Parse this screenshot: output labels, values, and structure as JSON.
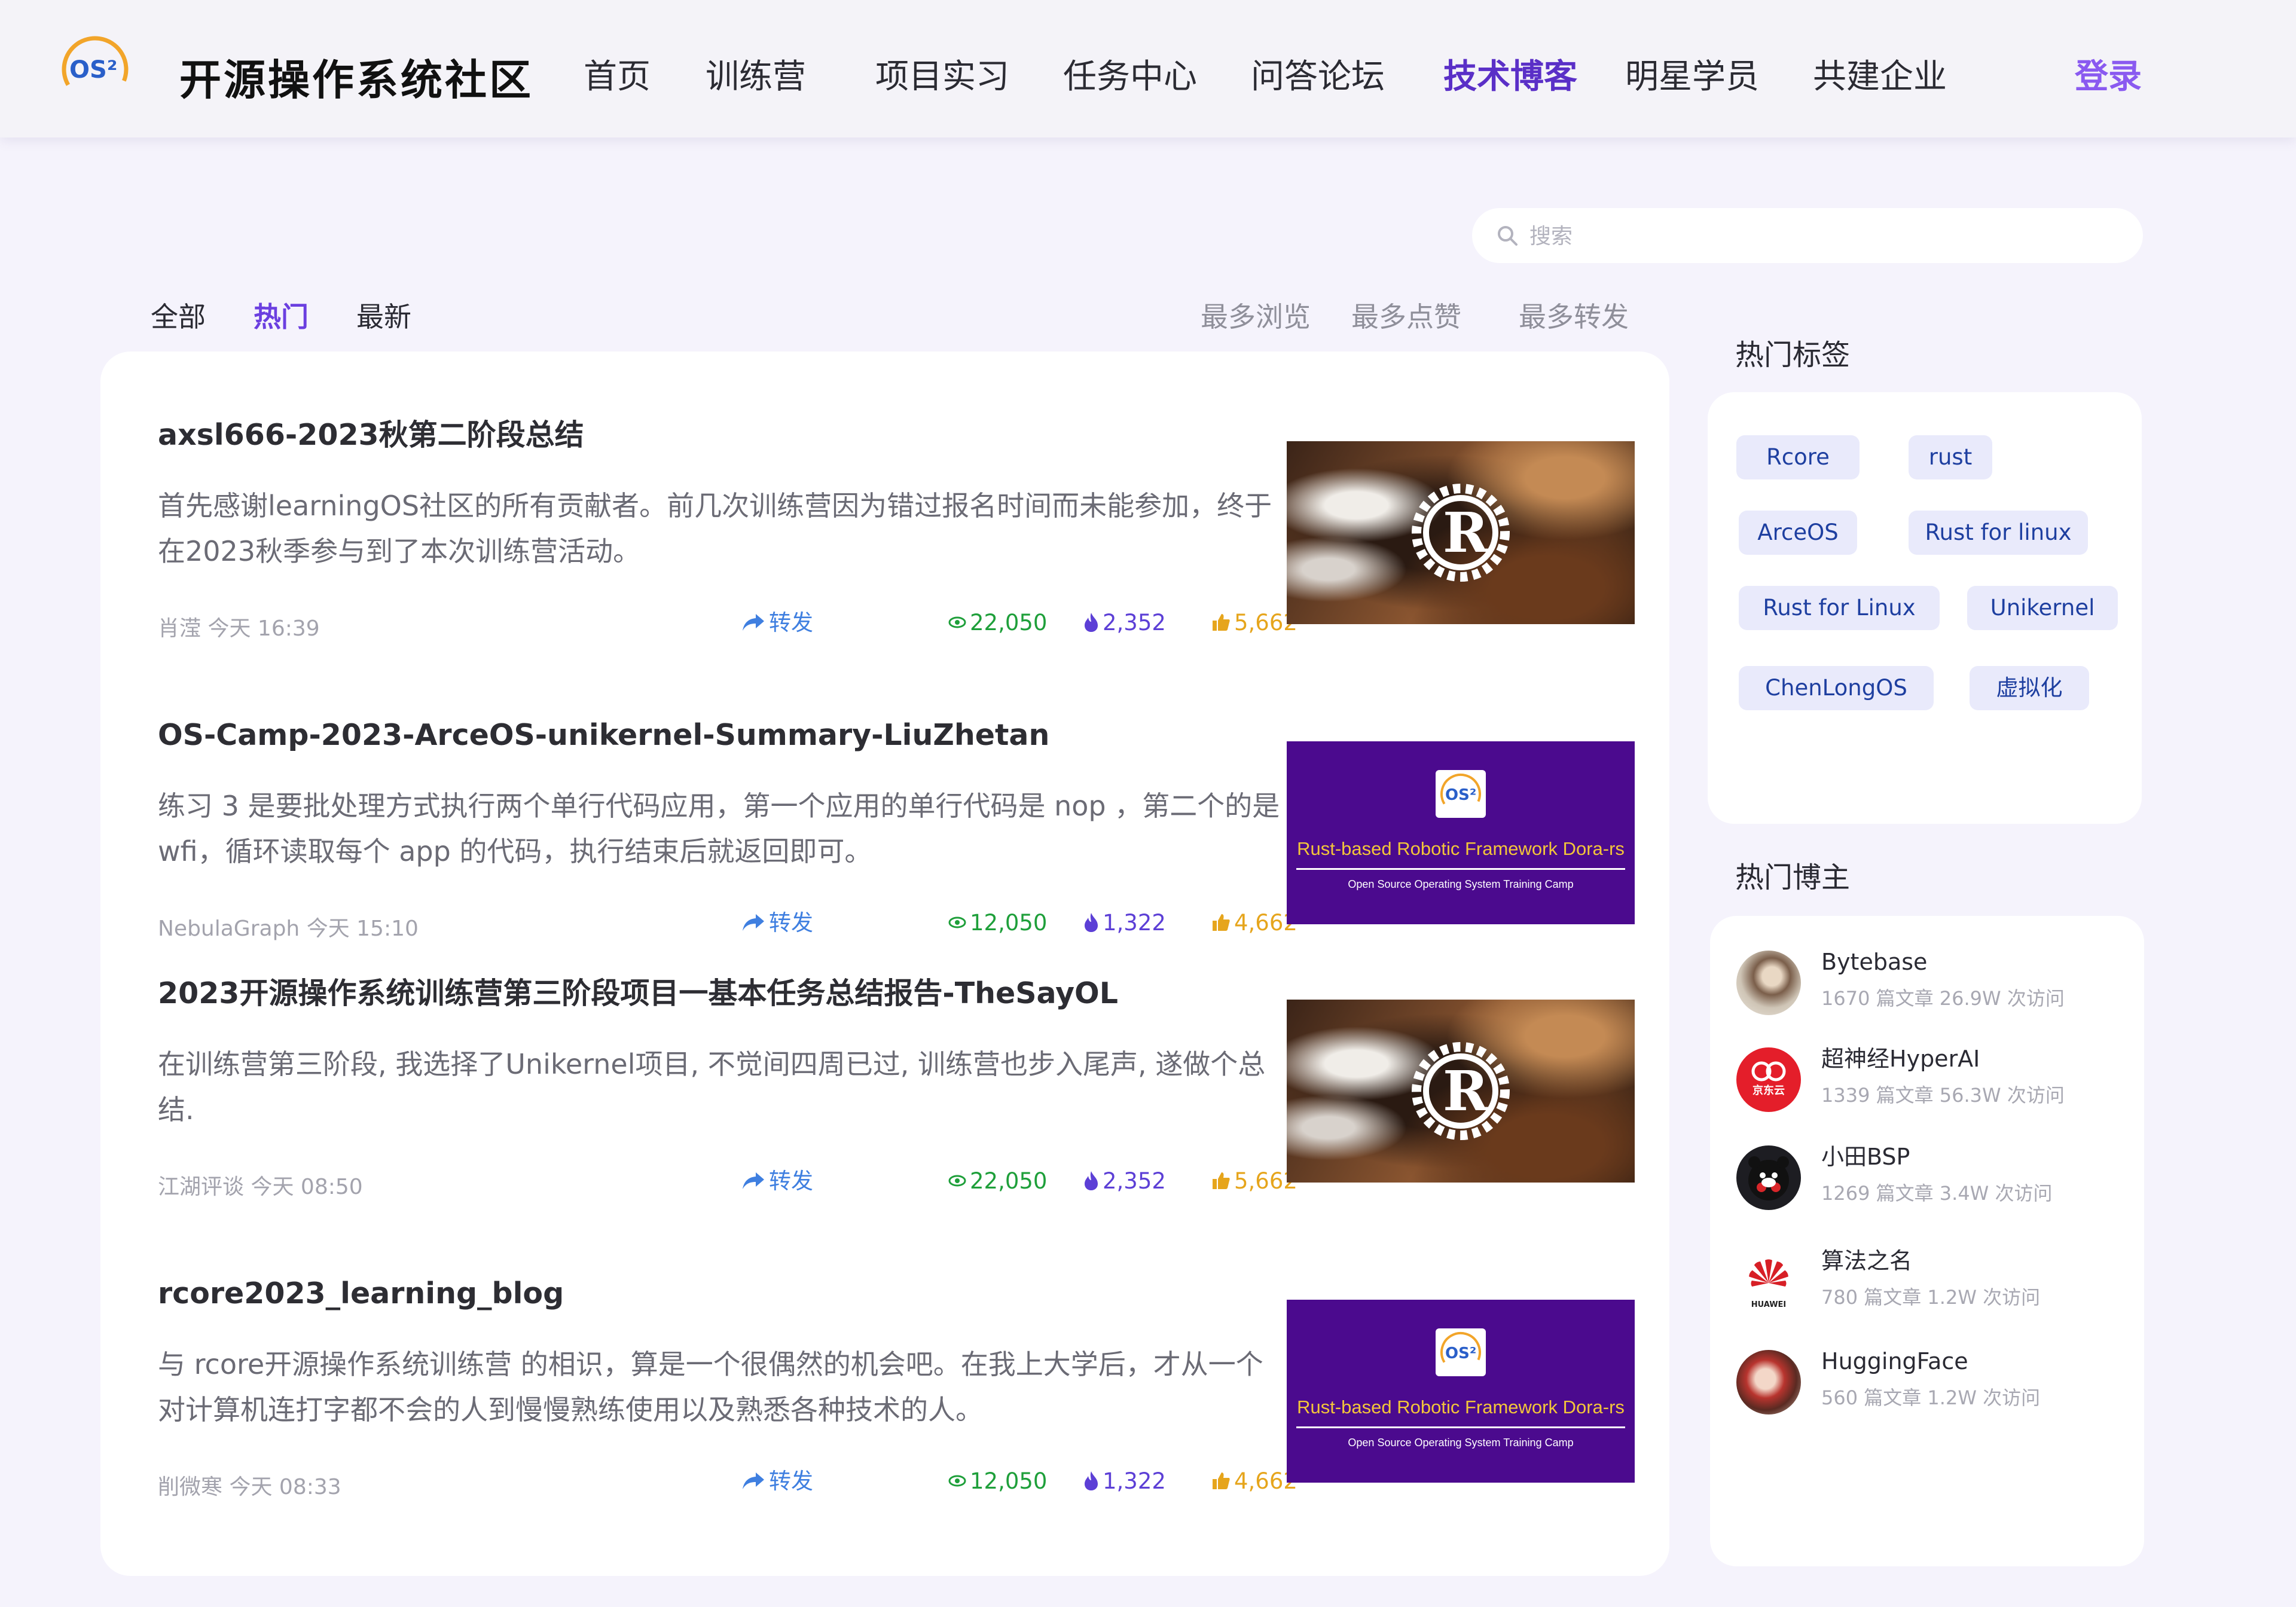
{
  "header": {
    "site_name": "开源操作系统社区",
    "logo_text": "OS²",
    "nav": [
      {
        "label": "首页"
      },
      {
        "label": "训练营"
      },
      {
        "label": "项目实习"
      },
      {
        "label": "任务中心"
      },
      {
        "label": "问答论坛"
      },
      {
        "label": "技术博客",
        "active": true
      },
      {
        "label": "明星学员"
      },
      {
        "label": "共建企业"
      }
    ],
    "login_label": "登录"
  },
  "search": {
    "placeholder": "搜索"
  },
  "filters": {
    "tabs": [
      {
        "label": "全部"
      },
      {
        "label": "热门",
        "active": true
      },
      {
        "label": "最新"
      }
    ],
    "sorts": [
      {
        "label": "最多浏览"
      },
      {
        "label": "最多点赞"
      },
      {
        "label": "最多转发"
      }
    ]
  },
  "posts": [
    {
      "title": "axsl666-2023秋第二阶段总结",
      "excerpt": "首先感谢learningOS社区的所有贡献者。前几次训练营因为错过报名时间而未能参加，终于在2023秋季参与到了本次训练营活动。",
      "author": "肖滢",
      "time": "今天 16:39",
      "share_label": "转发",
      "views": "22,050",
      "hot": "2,352",
      "likes": "5,662",
      "thumbnail": "rust-logo-image"
    },
    {
      "title": "OS-Camp-2023-ArceOS-unikernel-Summary-LiuZhetan",
      "excerpt": "练习 3 是要批处理方式执行两个单行代码应用，第一个应用的单行代码是 nop ，第二个的是 wfi，循环读取每个 app 的代码，执行结束后就返回即可。",
      "author": "NebulaGraph",
      "time": "今天 15:10",
      "share_label": "转发",
      "views": "12,050",
      "hot": "1,322",
      "likes": "4,662",
      "thumbnail": "dora-banner-image"
    },
    {
      "title": "2023开源操作系统训练营第三阶段项目一基本任务总结报告-TheSayOL",
      "excerpt": "在训练营第三阶段, 我选择了Unikernel项目, 不觉间四周已过, 训练营也步入尾声, 遂做个总结.",
      "author": "江湖评谈",
      "time": "今天 08:50",
      "share_label": "转发",
      "views": "22,050",
      "hot": "2,352",
      "likes": "5,662",
      "thumbnail": "rust-logo-image"
    },
    {
      "title": "rcore2023_learning_blog",
      "excerpt": "与 rcore开源操作系统训练营 的相识，算是一个很偶然的机会吧。在我上大学后，才从一个对计算机连打字都不会的人到慢慢熟练使用以及熟悉各种技术的人。",
      "author": "削微寒",
      "time": "今天 08:33",
      "share_label": "转发",
      "views": "12,050",
      "hot": "1,322",
      "likes": "4,662",
      "thumbnail": "dora-banner-image"
    }
  ],
  "banner": {
    "logo_text": "OS²",
    "title": "Rust-based Robotic Framework Dora-rs",
    "subtitle": "Open Source Operating System Training Camp"
  },
  "sidebar": {
    "tags_heading": "热门标签",
    "tags": [
      "Rcore",
      "rust",
      "ArceOS",
      "Rust for linux",
      "Rust for Linux",
      "Unikernel",
      "ChenLongOS",
      "虚拟化"
    ],
    "bloggers_heading": "热门博主",
    "bloggers": [
      {
        "name": "Bytebase",
        "stats": "1670 篇文章 26.9W 次访问",
        "avatar": "photo-avatar"
      },
      {
        "name": "超神经HyperAI",
        "stats": "1339 篇文章 56.3W 次访问",
        "avatar": "jd-cloud-avatar",
        "avatar_text": "京东云"
      },
      {
        "name": "小田BSP",
        "stats": "1269 篇文章 3.4W 次访问",
        "avatar": "kumamon-avatar"
      },
      {
        "name": "算法之名",
        "stats": "780 篇文章 1.2W 次访问",
        "avatar": "huawei-avatar",
        "avatar_text": "HUAWEI"
      },
      {
        "name": "HuggingFace",
        "stats": "560 篇文章 1.2W 次访问",
        "avatar": "photo-avatar"
      }
    ]
  },
  "colors": {
    "accent": "#5a2fc7",
    "login": "#8a5af0",
    "share": "#3f7fe0",
    "views": "#1e9f3a",
    "hot": "#5c3fd6",
    "likes": "#e6a51c",
    "tag_bg": "#e9eafb",
    "tag_text": "#1e3fa0",
    "page_bg": "#f5f3fc"
  }
}
